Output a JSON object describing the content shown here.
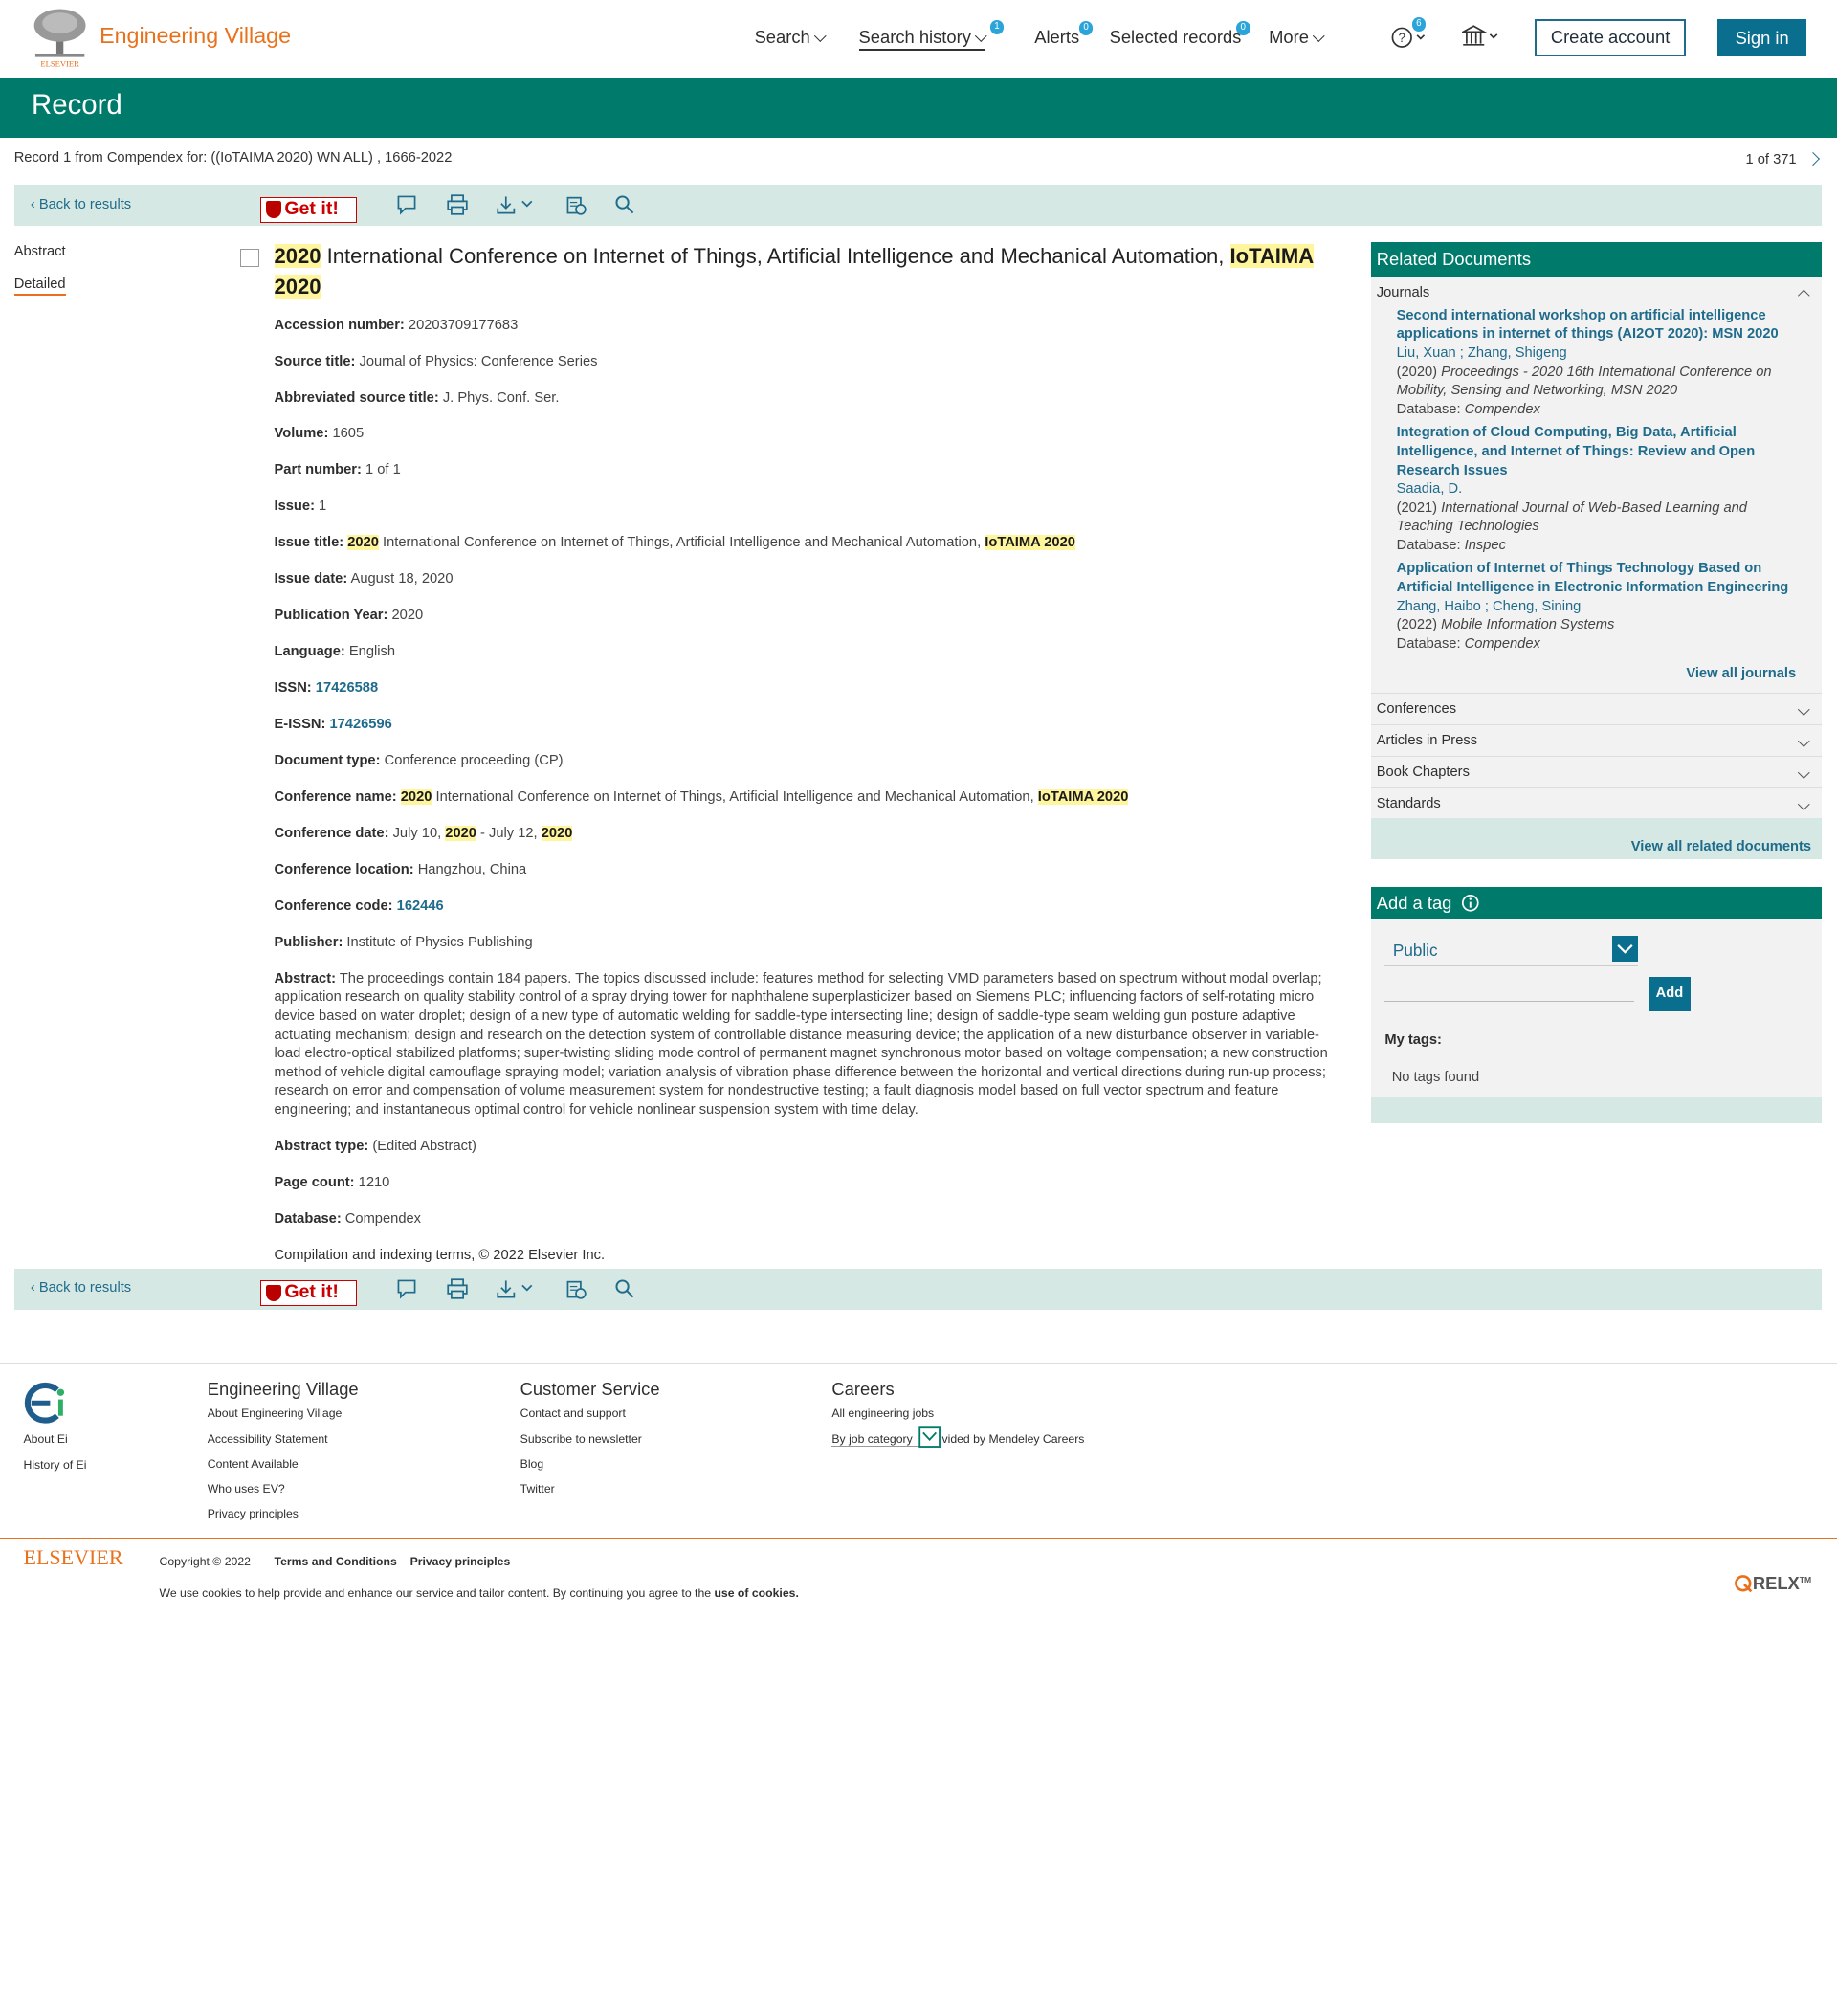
{
  "header": {
    "brand": "Engineering Village",
    "publisher_small": "ELSEVIER",
    "nav": {
      "search": "Search",
      "search_history": "Search history",
      "search_history_badge": "1",
      "alerts": "Alerts",
      "alerts_badge": "0",
      "selected_records": "Selected records",
      "selected_badge": "0",
      "more": "More",
      "help_badge": "6"
    },
    "create_account": "Create account",
    "sign_in": "Sign in"
  },
  "banner": {
    "title": "Record"
  },
  "record_line": "Record 1 from Compendex for: ((IoTAIMA 2020) WN ALL) , 1666-2022",
  "pager": "1 of 371",
  "toolbar": {
    "back": "Back to results",
    "getit": "Get it!"
  },
  "sidebar": {
    "abstract": "Abstract",
    "detailed": "Detailed"
  },
  "record": {
    "title_hl1": "2020",
    "title_mid": " International Conference on Internet of Things, Artificial Intelligence and Mechanical Automation, ",
    "title_hl2": "IoTAIMA 2020",
    "accession_label": "Accession number:",
    "accession": " 20203709177683",
    "source_label": "Source title:",
    "source": " Journal of Physics: Conference Series",
    "abbr_label": "Abbreviated source title:",
    "abbr": " J. Phys. Conf. Ser.",
    "volume_label": "Volume:",
    "volume": " 1605",
    "part_label": "Part number:",
    "part": " 1 of 1",
    "issue_label": "Issue:",
    "issue": " 1",
    "issue_title_label": "Issue title:",
    "issue_title_hl1": "2020",
    "issue_title_mid": " International Conference on Internet of Things, Artificial Intelligence and Mechanical Automation, ",
    "issue_title_hl2": "IoTAIMA 2020",
    "issue_date_label": "Issue date:",
    "issue_date": " August 18, 2020",
    "pubyear_label": "Publication Year:",
    "pubyear": " 2020",
    "language_label": "Language:",
    "language": " English",
    "issn_label": "ISSN:",
    "issn": "17426588",
    "eissn_label": "E-ISSN:",
    "eissn": "17426596",
    "doctype_label": "Document type:",
    "doctype": " Conference proceeding (CP)",
    "confname_label": "Conference name:",
    "confname_hl1": "2020",
    "confname_mid": " International Conference on Internet of Things, Artificial Intelligence and Mechanical Automation, ",
    "confname_hl2": "IoTAIMA 2020",
    "confdate_label": "Conference date:",
    "confdate_a": " July 10, ",
    "confdate_hl1": "2020",
    "confdate_b": " - July 12, ",
    "confdate_hl2": "2020",
    "confloc_label": "Conference location:",
    "confloc": " Hangzhou, China",
    "confcode_label": "Conference code:",
    "confcode": "162446",
    "publisher_label": "Publisher:",
    "publisher": " Institute of Physics Publishing",
    "abstract_label": "Abstract:",
    "abstract": " The proceedings contain 184 papers. The topics discussed include: features method for selecting VMD parameters based on spectrum without modal overlap; application research on quality stability control of a spray drying tower for naphthalene superplasticizer based on Siemens PLC; influencing factors of self-rotating micro device based on water droplet; design of a new type of automatic welding for saddle-type intersecting line; design of saddle-type seam welding gun posture adaptive actuating mechanism; design and research on the detection system of controllable distance measuring device; the application of a new disturbance observer in variable-load electro-optical stabilized platforms; super-twisting sliding mode control of permanent magnet synchronous motor based on voltage compensation; a new construction method of vehicle digital camouflage spraying model; variation analysis of vibration phase difference between the horizontal and vertical directions during run-up process; research on error and compensation of volume measurement system for nondestructive testing; a fault diagnosis model based on full vector spectrum and feature engineering; and instantaneous optimal control for vehicle nonlinear suspension system with time delay.",
    "abstype_label": "Abstract type:",
    "abstype": " (Edited Abstract)",
    "pagecount_label": "Page count:",
    "pagecount": " 1210",
    "database_label": "Database:",
    "database": " Compendex",
    "copyright": "Compilation and indexing terms, © 2022 Elsevier Inc."
  },
  "related": {
    "heading": "Related Documents",
    "journals": "Journals",
    "items": [
      {
        "title": "Second international workshop on artificial intelligence applications in internet of things (AI2OT 2020): MSN 2020",
        "authors": "Liu, Xuan ; Zhang, Shigeng",
        "year": "(2020)",
        "source": "Proceedings - 2020 16th International Conference on Mobility, Sensing and Networking, MSN 2020",
        "db_label": "Database:",
        "db": "Compendex"
      },
      {
        "title": "Integration of Cloud Computing, Big Data, Artificial Intelligence, and Internet of Things: Review and Open Research Issues",
        "authors": "Saadia, D.",
        "year": "(2021)",
        "source": "International Journal of Web-Based Learning and Teaching Technologies",
        "db_label": "Database:",
        "db": "Inspec"
      },
      {
        "title": "Application of Internet of Things Technology Based on Artificial Intelligence in Electronic Information Engineering",
        "authors": "Zhang, Haibo ; Cheng, Sining",
        "year": "(2022)",
        "source": "Mobile Information Systems",
        "db_label": "Database:",
        "db": "Compendex"
      }
    ],
    "view_all_journals": "View all journals",
    "conferences": "Conferences",
    "articles_in_press": "Articles in Press",
    "book_chapters": "Book Chapters",
    "standards": "Standards",
    "view_all_related": "View all related documents"
  },
  "tag": {
    "heading": "Add a tag",
    "visibility": "Public",
    "add": "Add",
    "my_tags": "My tags:",
    "no_tags": "No tags found"
  },
  "footer": {
    "ei_links": [
      "About Ei",
      "History of Ei"
    ],
    "ev_heading": "Engineering Village",
    "ev_links": [
      "About Engineering Village",
      "Accessibility Statement",
      "Content Available",
      "Who uses EV?",
      "Privacy principles"
    ],
    "cs_heading": "Customer Service",
    "cs_links": [
      "Contact and support",
      "Subscribe to newsletter",
      "Blog",
      "Twitter"
    ],
    "careers_heading": "Careers",
    "careers_links": [
      "All engineering jobs",
      "By job category"
    ],
    "careers_provided": "vided by Mendeley Careers",
    "elsevier": "ELSEVIER",
    "copyright": "Copyright © 2022",
    "terms": "Terms and Conditions",
    "privacy": "Privacy principles",
    "cookies_a": "We use cookies to help provide and enhance our service and tailor content. By continuing you agree to the ",
    "cookies_b": "use of cookies.",
    "relx": "RELX"
  },
  "colors": {
    "brand_orange": "#e9711c",
    "banner_teal": "#007a6a",
    "link_blue": "#1f6b8c",
    "highlight": "#fff59d"
  }
}
